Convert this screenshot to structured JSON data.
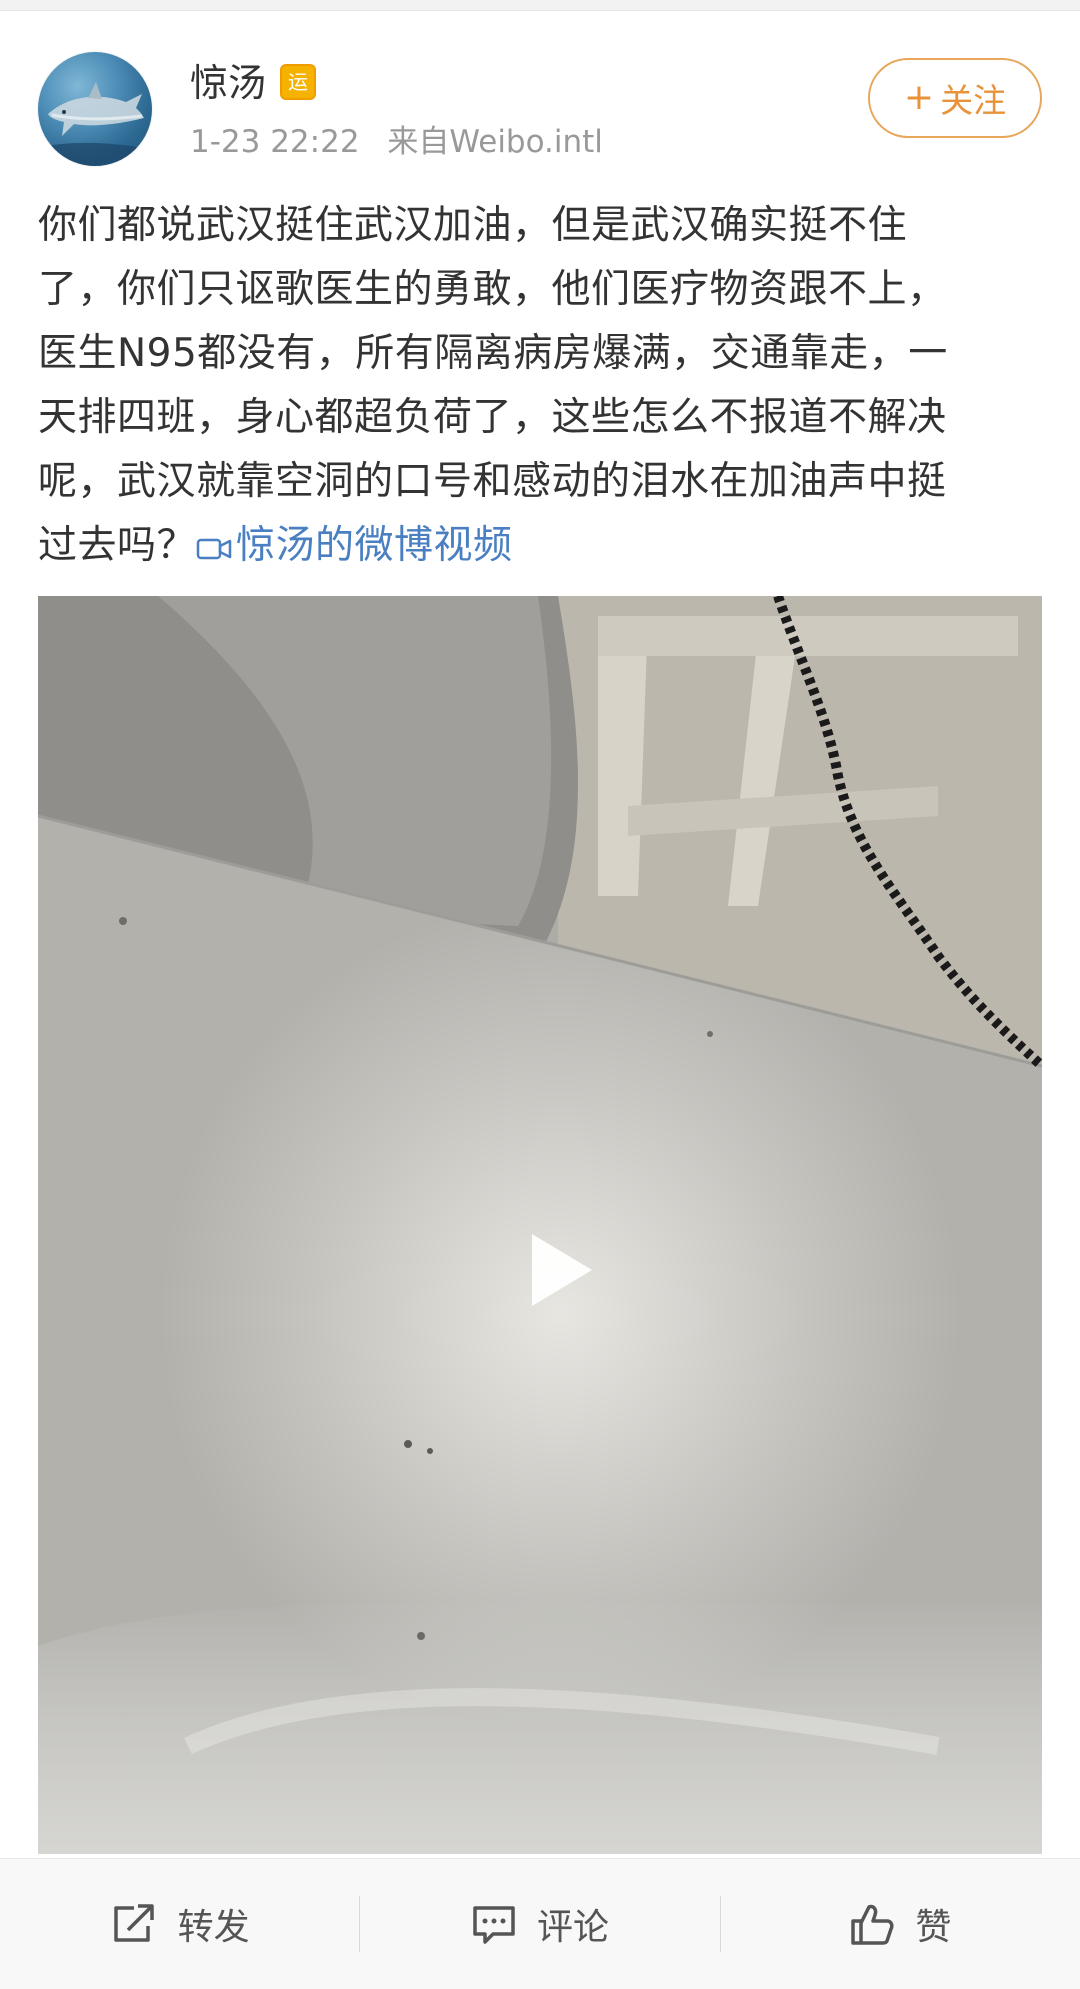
{
  "user": {
    "name": "惊汤",
    "badge": "运",
    "time": "1-23 22:22",
    "source": "来自Weibo.intl",
    "avatar_icon": "shark-avatar-icon"
  },
  "follow_button": {
    "plus": "+",
    "label": "关注"
  },
  "post": {
    "lines": [
      "你们都说武汉挺住武汉加油，但是武汉确实挺不住",
      "了，你们只讴歌医生的勇敢，他们医疗物资跟不上，",
      "医生N95都没有，所有隔离病房爆满，交通靠走，一",
      "天排四班，身心都超负荷了，这些怎么不报道不解决",
      "呢，武汉就靠空洞的口号和感动的泪水在加油声中挺"
    ],
    "last_line_text": "过去吗？",
    "video_link": "惊汤的微博视频",
    "video_link_icon": "video-camera-icon"
  },
  "video": {
    "play_icon": "play-icon"
  },
  "actions": {
    "repost": "转发",
    "comment": "评论",
    "like": "赞",
    "repost_icon": "share-icon",
    "comment_icon": "comment-icon",
    "like_icon": "thumbs-up-icon"
  },
  "colors": {
    "follow_accent": "#e8933a",
    "link": "#4a7fc1",
    "meta_text": "#999999",
    "badge": "#f6b200"
  }
}
